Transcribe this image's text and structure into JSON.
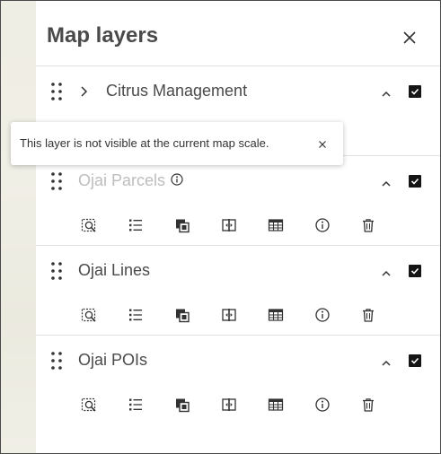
{
  "panel": {
    "title": "Map layers",
    "close_icon": "close-icon"
  },
  "tooltip": {
    "text": "This layer is not visible at the current map scale.",
    "close_icon": "close-icon"
  },
  "layers": [
    {
      "name": "Citrus Management",
      "visible_at_scale": true,
      "checked": true,
      "expandable": true
    },
    {
      "name": "Ojai Parcels",
      "visible_at_scale": false,
      "checked": true,
      "expandable": false
    },
    {
      "name": "Ojai Lines",
      "visible_at_scale": true,
      "checked": true,
      "expandable": false
    },
    {
      "name": "Ojai POIs",
      "visible_at_scale": true,
      "checked": true,
      "expandable": false
    }
  ],
  "layer_actions": [
    "zoom-to-icon",
    "legend-list-icon",
    "layers-copy-icon",
    "swipe-compare-icon",
    "attribute-table-icon",
    "info-icon",
    "trash-icon"
  ],
  "colors": {
    "panel_bg": "#ffffff",
    "text": "#4a4a4a",
    "dim_text": "#bdbdbd",
    "checkbox": "#151515",
    "map_bg": "#f1f0e8"
  }
}
